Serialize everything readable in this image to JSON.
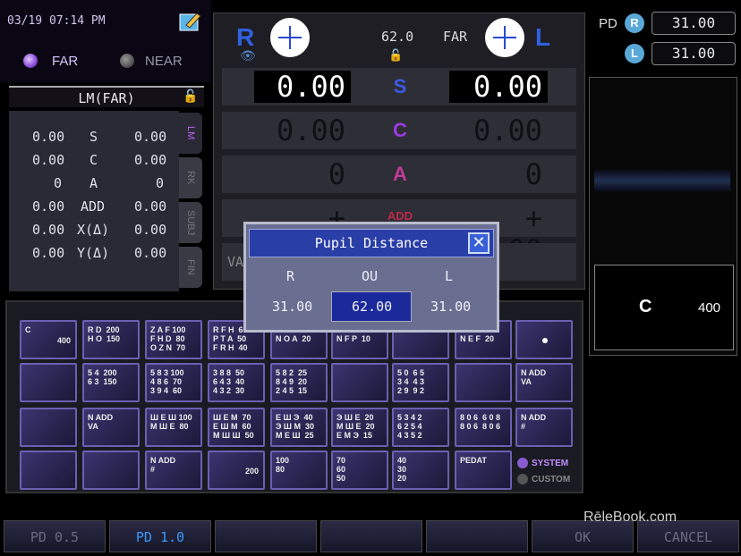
{
  "datetime": "03/19 07:14 PM",
  "mode": {
    "far_label": "FAR",
    "near_label": "NEAR"
  },
  "lm": {
    "title": "LM(FAR)",
    "rows": [
      {
        "r": "0.00",
        "label": "S",
        "l": "0.00"
      },
      {
        "r": "0.00",
        "label": "C",
        "l": "0.00"
      },
      {
        "r": "0",
        "label": "A",
        "l": "0"
      },
      {
        "r": "0.00",
        "label": "ADD",
        "l": "0.00"
      },
      {
        "r": "0.00",
        "label": "X(Δ)",
        "l": "0.00"
      },
      {
        "r": "0.00",
        "label": "Y(Δ)",
        "l": "0.00"
      }
    ],
    "tabs": [
      "LM",
      "RK",
      "SUBJ",
      "FIN"
    ]
  },
  "center": {
    "r_label": "R",
    "l_label": "L",
    "pd_value": "62.0",
    "distance_label": "FAR",
    "rows": [
      {
        "label": "S",
        "r": "0.00",
        "l": "0.00"
      },
      {
        "label": "C",
        "r": "0.00",
        "l": "0.00"
      },
      {
        "label": "A",
        "r": "0",
        "l": "0"
      },
      {
        "label": "ADD",
        "r": "+ 0.00",
        "l": "+ 0.00"
      }
    ],
    "va_label": "VA"
  },
  "pd_panel": {
    "label": "PD",
    "r_circle": "R",
    "l_circle": "L",
    "r_value": "31.00",
    "l_value": "31.00"
  },
  "preview": {
    "letter": "C",
    "number": "400"
  },
  "charts": [
    {
      "text": "C",
      "num": "400"
    },
    {
      "text": "R D  200\nH O  150"
    },
    {
      "text": "Z A F 100\nF H D  80\nO Z N  70"
    },
    {
      "text": "R F H  60\nP T A  50\nF R H  40"
    },
    {
      "text": "D Z F  25\nN O A  20"
    },
    {
      "text": "E O A  15\nN F P  10"
    },
    {
      "text": ""
    },
    {
      "text": "R T H  20\nN E F  20"
    },
    {
      "text": ""
    },
    {
      "text": "5 4  200\n6 3  150"
    },
    {
      "text": "5 8 3 100\n4 8 6  70\n3 9 4  60"
    },
    {
      "text": "3 8 8  50\n6 4 3  40\n4 3 2  30"
    },
    {
      "text": "5 8 2  25\n8 4 9  20\n2 4 5  15"
    },
    {
      "text": ""
    },
    {
      "text": "5 0  6 5\n3 4  4 3\n2 9  9 2"
    },
    {
      "text": ""
    },
    {
      "text": ""
    },
    {
      "text": "N ADD\nVA"
    },
    {
      "text": "Ш E Ш 100\nM Ш E  80"
    },
    {
      "text": "Ш E M  70\nE Ш M  60\nM Ш Ш  50"
    },
    {
      "text": "E Ш Э  40\nЭ Ш M  30\nM E Ш  25"
    },
    {
      "text": "Э Ш E  20\nM Ш E  20\nE M Э  15"
    },
    {
      "text": "5 3 4 2\n6 2 5 4\n4 3 5 2"
    },
    {
      "text": "8 0 6  6 0 8\n8 0 6  8 0 6"
    },
    {
      "text": ""
    },
    {
      "text": ""
    },
    {
      "text": "N ADD\n#"
    },
    {
      "text": "",
      "num": "200"
    },
    {
      "text": "100\n80"
    },
    {
      "text": "70\n60\n50"
    },
    {
      "text": "40\n30\n20"
    },
    {
      "text": "PEDAT"
    },
    {
      "text": ""
    },
    {
      "text": ""
    },
    {
      "text": ""
    }
  ],
  "system_label": "SYSTEM",
  "custom_label": "CUSTOM",
  "buttons": [
    "PD 0.5",
    "PD 1.0",
    "",
    "",
    "",
    "OK",
    "CANCEL"
  ],
  "watermark": "RēleBook.com",
  "dialog": {
    "title": "Pupil Distance",
    "r_header": "R",
    "ou_header": "OU",
    "l_header": "L",
    "r_value": "31.00",
    "ou_value": "62.00",
    "l_value": "31.00"
  }
}
